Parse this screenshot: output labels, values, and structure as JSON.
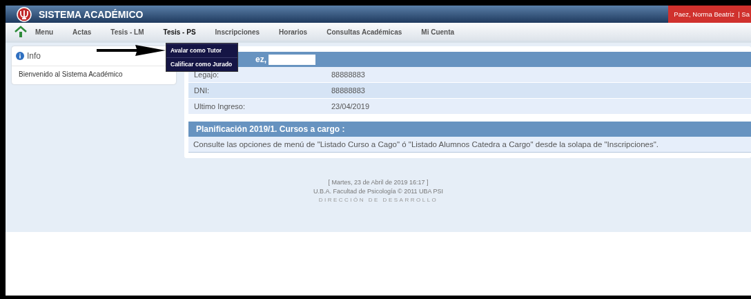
{
  "header": {
    "title": "SISTEMA ACADÉMICO",
    "user": "Paez, Norma Beatriz  | Sa"
  },
  "nav": {
    "items": [
      {
        "label": "Menu",
        "selected": false
      },
      {
        "label": "Actas",
        "selected": false
      },
      {
        "label": "Tesis - LM",
        "selected": false
      },
      {
        "label": "Tesis - PS",
        "selected": true
      },
      {
        "label": "Inscripciones",
        "selected": false
      },
      {
        "label": "Horarios",
        "selected": false
      },
      {
        "label": "Consultas Académicas",
        "selected": false
      },
      {
        "label": "Mi Cuenta",
        "selected": false
      }
    ]
  },
  "dropdown": {
    "items": [
      "Avalar como Tutor",
      "Calificar como Jurado"
    ]
  },
  "info": {
    "title": "Info",
    "text": "Bienvenido al Sistema Académico"
  },
  "profile": {
    "title": "ez,",
    "rows": [
      {
        "label": "Legajo:",
        "value": "88888883"
      },
      {
        "label": "DNI:",
        "value": "88888883"
      },
      {
        "label": "Ultimo Ingreso:",
        "value": "23/04/2019"
      }
    ]
  },
  "planning": {
    "title": "Planificación 2019/1. Cursos a cargo :",
    "text": "Consulte las opciones de menú de \"Listado Curso a Cago\" ó \"Listado Alumnos Catedra a Cargo\" desde la solapa de \"Inscripciones\"."
  },
  "footer": {
    "date": "[  Martes, 23 de Abril de 2019 16:17  ]",
    "copyright": "U.B.A. Facultad de Psicología © 2011 UBA PSI",
    "credit": "DIRECCIÓN DE DESARROLLO"
  }
}
